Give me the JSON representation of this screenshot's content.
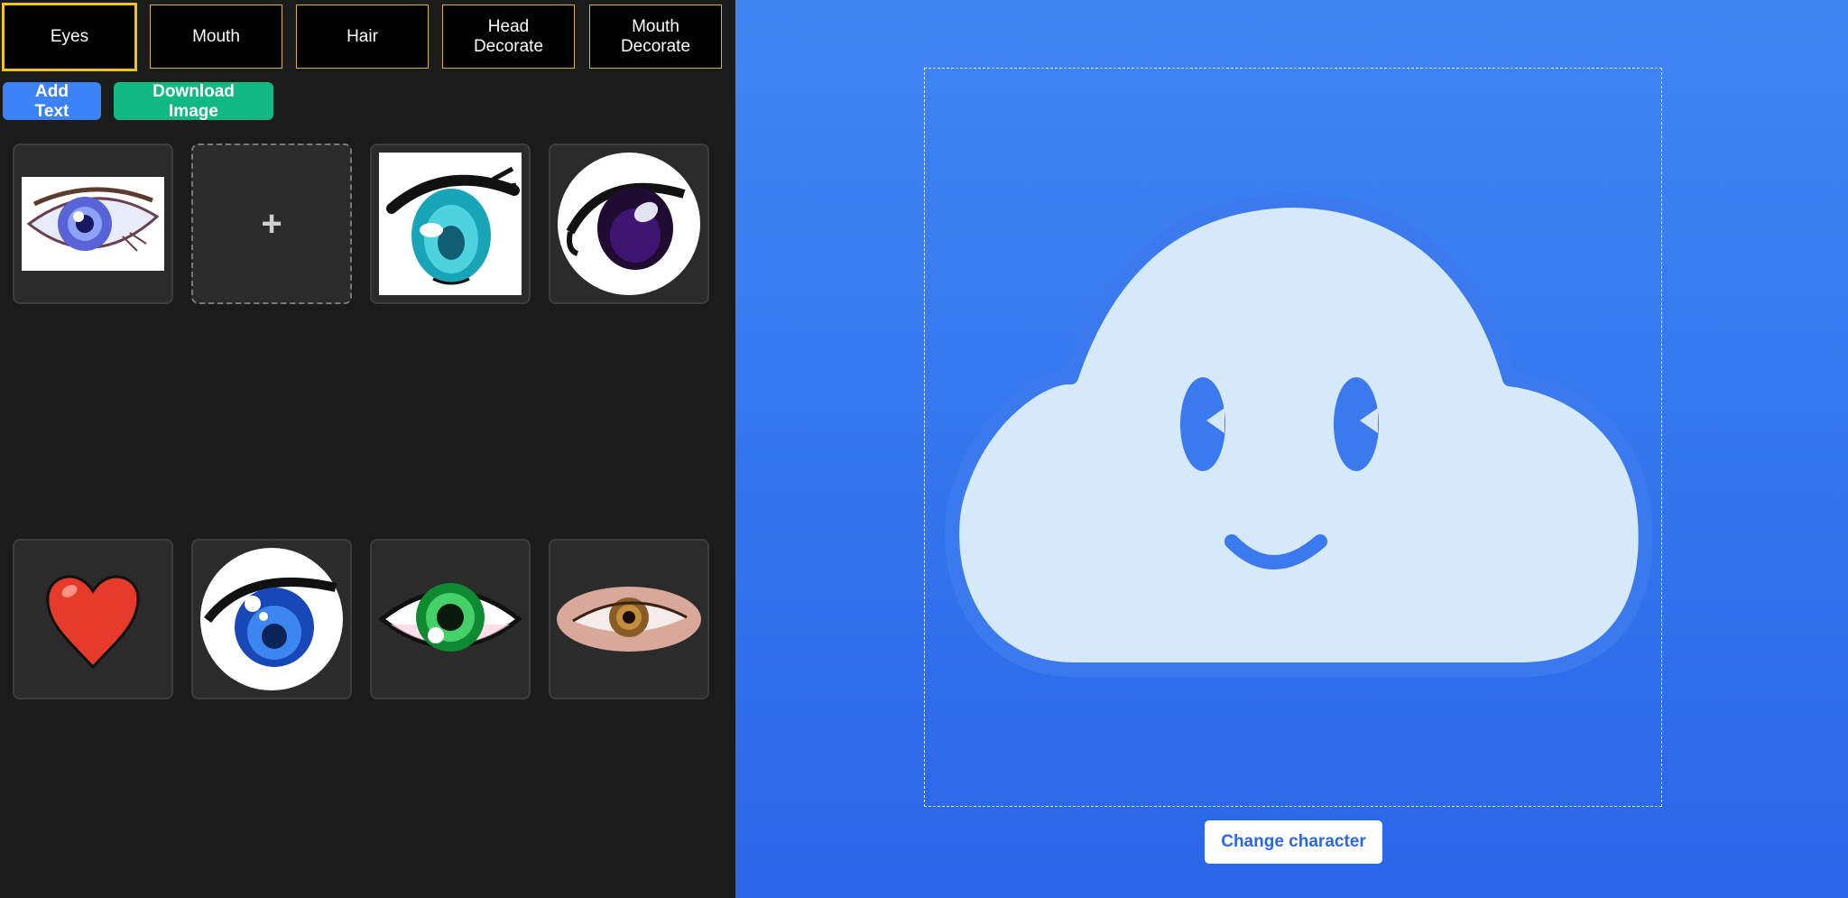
{
  "tabs": [
    {
      "label": "Eyes",
      "active": true
    },
    {
      "label": "Mouth",
      "active": false
    },
    {
      "label": "Hair",
      "active": false
    },
    {
      "label": "Head\nDecorate",
      "active": false
    },
    {
      "label": "Mouth\nDecorate",
      "active": false
    }
  ],
  "toolbar": {
    "add_text_label": "Add Text",
    "download_label": "Download Image",
    "add_text_color": "#3b82f6",
    "download_color": "#10b981"
  },
  "gallery": {
    "add_symbol": "+",
    "items": [
      {
        "name": "realistic-blue-eye-icon"
      },
      {
        "name": "add-image-slot"
      },
      {
        "name": "anime-teal-eye-icon"
      },
      {
        "name": "purple-anime-eye-icon"
      },
      {
        "name": "heart-icon"
      },
      {
        "name": "blue-anime-eye-icon"
      },
      {
        "name": "green-cartoon-eye-icon"
      },
      {
        "name": "realistic-brown-eye-icon"
      }
    ]
  },
  "canvas": {
    "character": "cloud-character-icon",
    "background_top": "#3f86f3",
    "background_bottom": "#2a66e8",
    "cloud_fill": "#d6e9fb",
    "cloud_stroke": "#3b79ee",
    "face_color": "#3b79ee"
  },
  "change_character_label": "Change character"
}
